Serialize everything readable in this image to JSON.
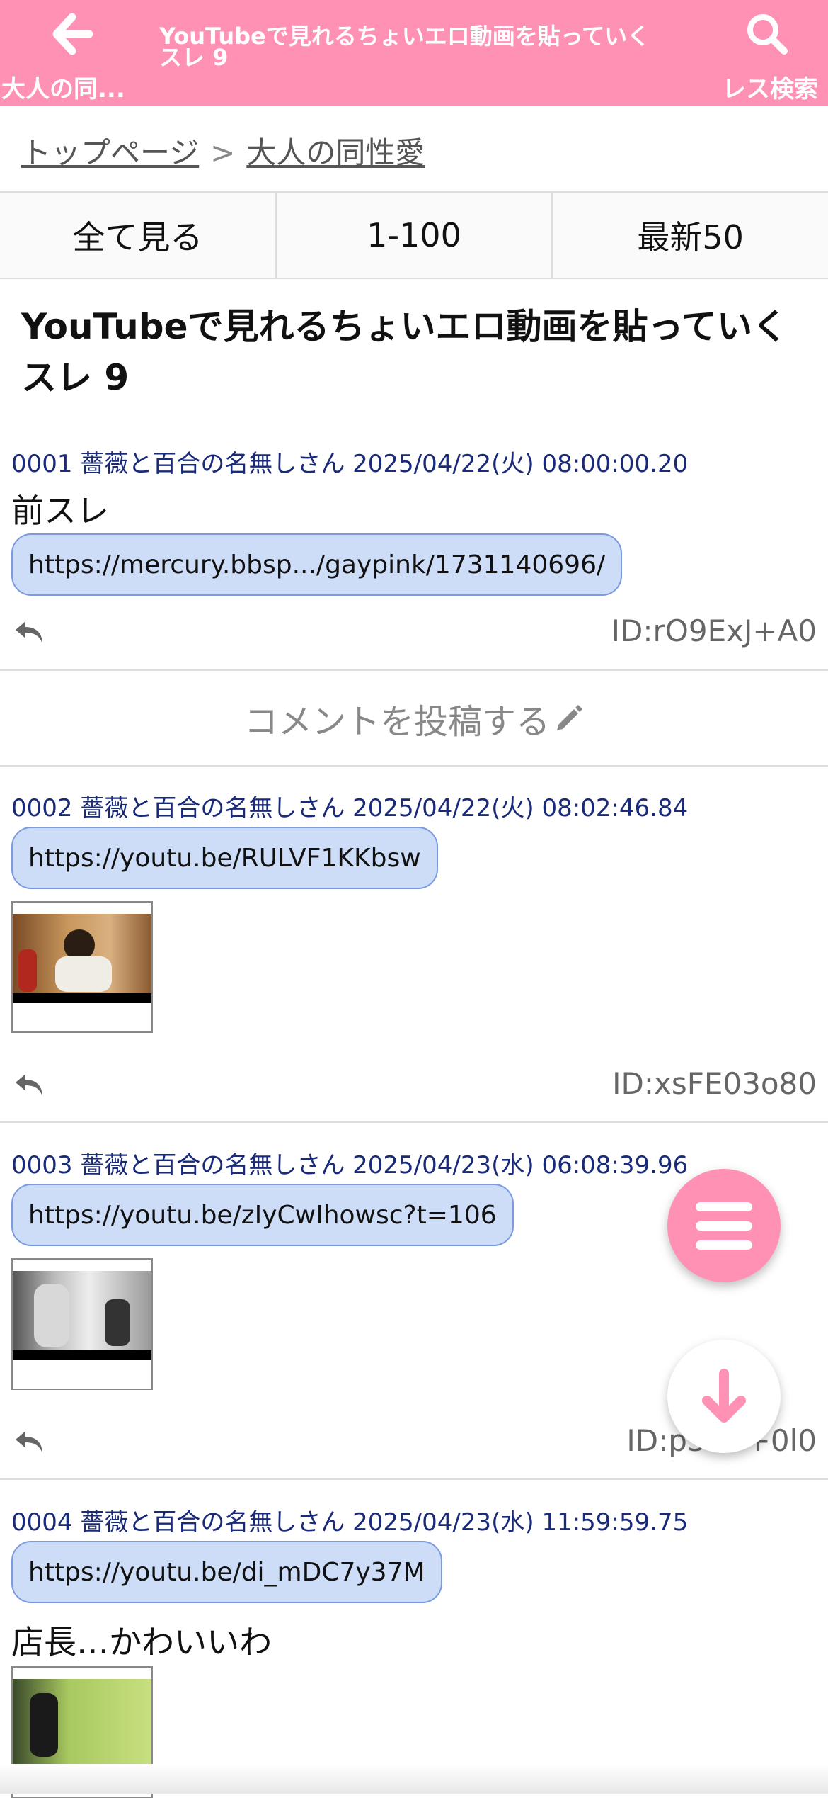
{
  "header": {
    "back_label": "大人の同...",
    "title": "YouTubeで見れるちょいエロ動画を貼っていくスレ 9",
    "search_label": "レス検索",
    "color": "#ff91b5"
  },
  "breadcrumb": {
    "home": "トップページ",
    "separator": ">",
    "board": "大人の同性愛"
  },
  "range_nav": [
    "全て見る",
    "1-100",
    "最新50"
  ],
  "thread_title": "YouTubeで見れるちょいエロ動画を貼っていくスレ 9",
  "comment_bar": "コメントを投稿する",
  "posts": [
    {
      "header": "0001 薔薇と百合の名無しさん 2025/04/22(火) 08:00:00.20",
      "text": "前スレ",
      "link": "https://mercury.bbsp.../gaypink/1731140696/",
      "id": "ID:rO9ExJ+A0"
    },
    {
      "header": "0002 薔薇と百合の名無しさん 2025/04/22(火) 08:02:46.84",
      "link": "https://youtu.be/RULVF1KKbsw",
      "id": "ID:xsFE03o80"
    },
    {
      "header": "0003 薔薇と百合の名無しさん 2025/04/23(水) 06:08:39.96",
      "link": "https://youtu.be/zIyCwIhowsc?t=106",
      "id": "ID:p3C7+0l0"
    },
    {
      "header": "0004 薔薇と百合の名無しさん 2025/04/23(水) 11:59:59.75",
      "link": "https://youtu.be/di_mDC7y37M",
      "text": "店長…かわいいわ"
    }
  ],
  "icons": {
    "back": "arrow-left-icon",
    "search": "search-icon",
    "reply": "reply-icon",
    "pencil": "pencil-icon",
    "menu": "menu-icon",
    "scroll_down": "arrow-down-icon"
  }
}
